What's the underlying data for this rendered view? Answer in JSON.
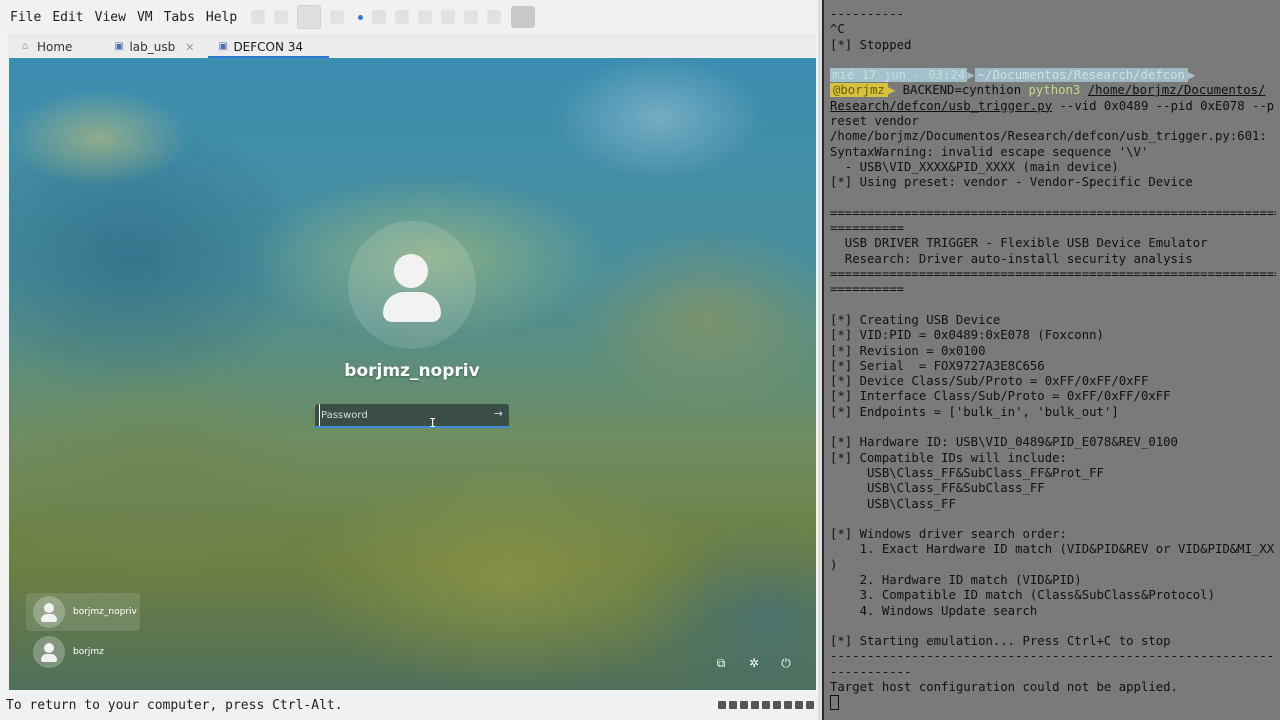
{
  "menubar": {
    "items": [
      "File",
      "Edit",
      "View",
      "VM",
      "Tabs",
      "Help"
    ]
  },
  "tabs": [
    {
      "label": "Home",
      "active": false
    },
    {
      "label": "lab_usb",
      "active": false
    },
    {
      "label": "DEFCON 34",
      "active": true
    }
  ],
  "login": {
    "username": "borjmz_nopriv",
    "password_placeholder": "Password",
    "users": [
      "borjmz_nopriv",
      "borjmz"
    ]
  },
  "statusbar": {
    "text": "To return to your computer, press Ctrl-Alt."
  },
  "terminal": {
    "prompt": {
      "datetime": "mié 17 jun - 03:24",
      "cwd": "~/Documentos/Research/defcon",
      "user": "@borjmz"
    },
    "command_env": "BACKEND=cynthion",
    "command_python": "python3",
    "command_file": "/home/borjmz/Documentos/",
    "command_file_2": "Research/defcon/usb_trigger.py",
    "command_args": " --vid 0x0489 --pid 0xE078 --p",
    "lines": [
      "----------",
      "^C",
      "[*] Stopped",
      "reset vendor",
      "/home/borjmz/Documentos/Research/defcon/usb_trigger.py:601:",
      "SyntaxWarning: invalid escape sequence '\\V'",
      "  - USB\\VID_XXXX&PID_XXXX (main device)",
      "[*] Using preset: vendor - Vendor-Specific Device",
      "",
      "=============================================================",
      "==========",
      "  USB DRIVER TRIGGER - Flexible USB Device Emulator",
      "  Research: Driver auto-install security analysis",
      "=============================================================",
      "==========",
      "",
      "[*] Creating USB Device",
      "[*] VID:PID = 0x0489:0xE078 (Foxconn)",
      "[*] Revision = 0x0100",
      "[*] Serial  = FOX9727A3E8C656",
      "[*] Device Class/Sub/Proto = 0xFF/0xFF/0xFF",
      "[*] Interface Class/Sub/Proto = 0xFF/0xFF/0xFF",
      "[*] Endpoints = ['bulk_in', 'bulk_out']",
      "",
      "[*] Hardware ID: USB\\VID_0489&PID_E078&REV_0100",
      "[*] Compatible IDs will include:",
      "     USB\\Class_FF&SubClass_FF&Prot_FF",
      "     USB\\Class_FF&SubClass_FF",
      "     USB\\Class_FF",
      "",
      "[*] Windows driver search order:",
      "    1. Exact Hardware ID match (VID&PID&REV or VID&PID&MI_XX",
      ")",
      "    2. Hardware ID match (VID&PID)",
      "    3. Compatible ID match (Class&SubClass&Protocol)",
      "    4. Windows Update search",
      "",
      "[*] Starting emulation... Press Ctrl+C to stop",
      "-------------------------------------------------------------",
      "-----------",
      "Target host configuration could not be applied."
    ]
  }
}
